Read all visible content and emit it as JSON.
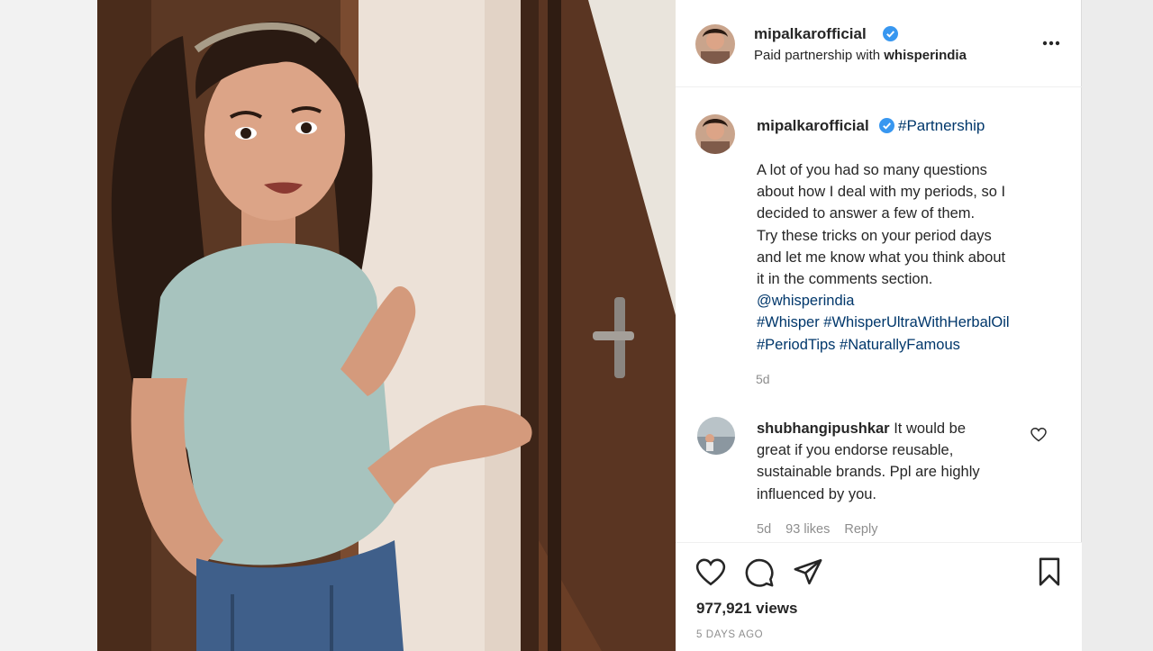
{
  "post": {
    "username": "mipalkarofficial",
    "verified": true,
    "partnership_prefix": "Paid partnership with ",
    "partner": "whisperindia",
    "more_icon": "more-horizontal-icon"
  },
  "caption": {
    "username": "mipalkarofficial",
    "tag": "#Partnership",
    "lines": [
      "A lot of you had so many questions",
      "about how I deal with my periods, so I",
      "decided to answer a few of them.",
      "Try these tricks on your period days",
      "and let me know what you think about",
      "it in the comments section."
    ],
    "mention": "@whisperindia",
    "hashtags_line1": "#Whisper #WhisperUltraWithHerbalOil",
    "hashtags_line2": "#PeriodTips #NaturallyFamous",
    "age": "5d"
  },
  "comment": {
    "username": "shubhangipushkar",
    "lines": [
      " It would be",
      "great if you endorse reusable,",
      "sustainable brands. Ppl are highly",
      "influenced by you."
    ],
    "age": "5d",
    "likes": "93 likes",
    "reply": "Reply"
  },
  "actions": {
    "icons": [
      "heart-icon",
      "comment-icon",
      "share-icon",
      "bookmark-icon"
    ],
    "views": "977,921 views",
    "posted": "5 DAYS AGO"
  },
  "colors": {
    "link": "#00376b",
    "verified": "#3897f0",
    "muted": "#8e8e8e",
    "text": "#262626"
  }
}
